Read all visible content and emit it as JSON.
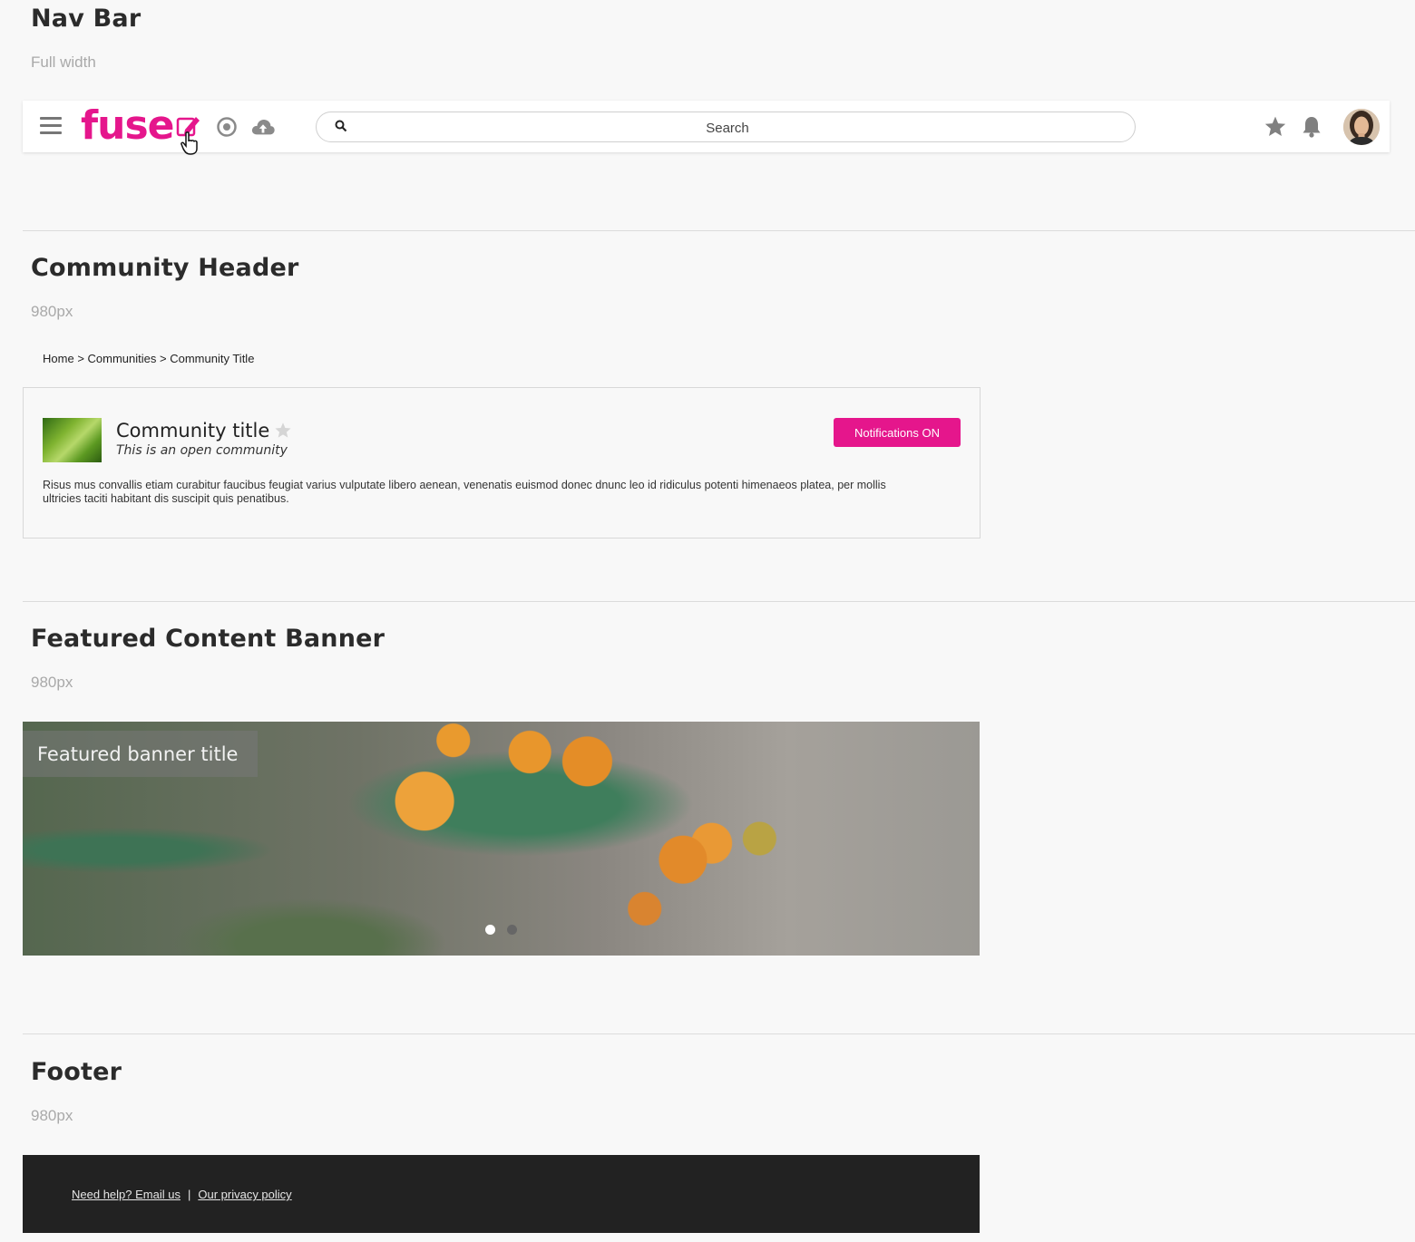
{
  "sections": {
    "nav": {
      "title": "Nav Bar",
      "subtitle": "Full width"
    },
    "community": {
      "title": "Community Header",
      "subtitle": "980px"
    },
    "banner": {
      "title": "Featured Content Banner",
      "subtitle": "980px"
    },
    "footer": {
      "title": "Footer",
      "subtitle": "980px"
    }
  },
  "navbar": {
    "logo": "fuse",
    "icons": [
      "menu-icon",
      "edit-icon",
      "target-icon",
      "cloud-upload-icon",
      "search-icon",
      "star-icon",
      "bell-icon"
    ],
    "search": {
      "placeholder": "Search"
    },
    "brand_color": "#e5168c"
  },
  "breadcrumb": {
    "home": "Home",
    "separator": ">",
    "communities": "Communities",
    "current": "Community Title"
  },
  "community": {
    "title": "Community title",
    "subtitle": "This is an open community",
    "notifications_label": "Notifications ON",
    "description": "Risus mus convallis etiam curabitur faucibus feugiat varius vulputate libero aenean, venenatis euismod donec dnunc leo id ridiculus potenti himenaeos platea, per mollis ultricies taciti habitant dis suscipit quis penatibus."
  },
  "banner": {
    "title": "Featured banner title",
    "slides": 2,
    "active_slide": 1
  },
  "footer": {
    "help_link": "Need help? Email us",
    "divider": "|",
    "privacy_link": "Our privacy policy"
  }
}
